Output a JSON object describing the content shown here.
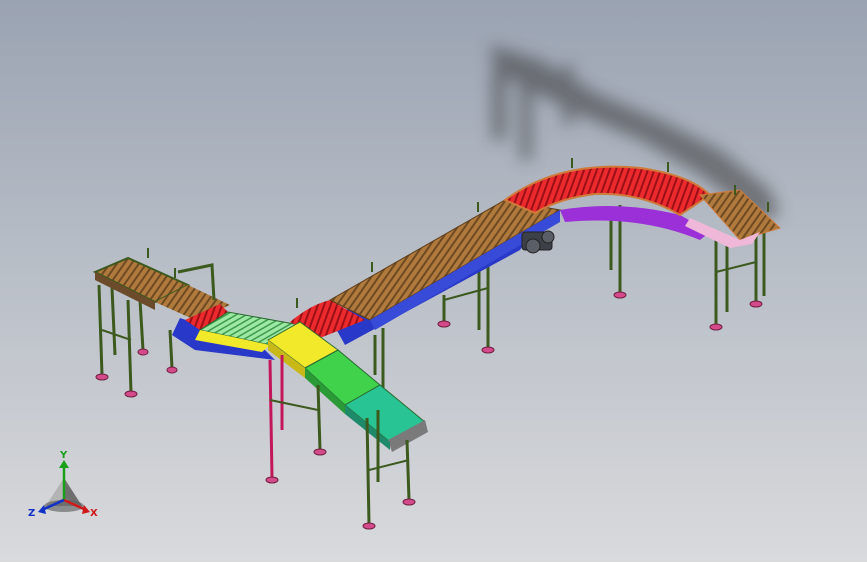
{
  "viewport": {
    "model": "conveyor-assembly",
    "background": "gradient-gray"
  },
  "colors": {
    "frame_leg": "#3d5a1e",
    "pink_leg": "#c2185b",
    "roller_tan": "#b07a3c",
    "roller_red": "#e8262b",
    "side_blue": "#2838c8",
    "side_purple": "#9b30d8",
    "yellow_panel": "#f2e92a",
    "green_belt": "#3fd24a",
    "teal_belt": "#28c493",
    "pink_end": "#f0b8d8",
    "foot": "#d44a8a"
  },
  "triad": {
    "x_label": "X",
    "y_label": "Y",
    "z_label": "Z",
    "x_color": "#d01818",
    "y_color": "#18a018",
    "z_color": "#1030c8"
  }
}
